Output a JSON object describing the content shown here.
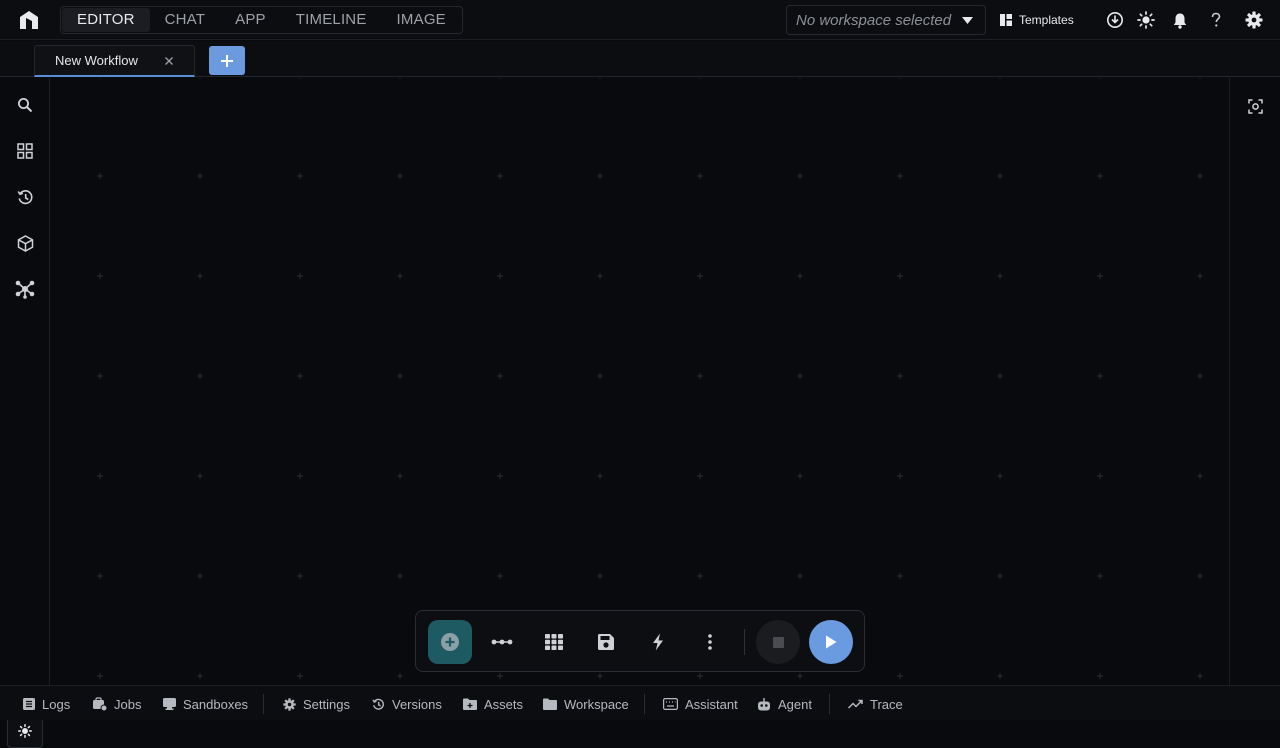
{
  "header": {
    "modes": [
      {
        "label": "EDITOR",
        "active": true
      },
      {
        "label": "CHAT",
        "active": false
      },
      {
        "label": "APP",
        "active": false
      },
      {
        "label": "TIMELINE",
        "active": false
      },
      {
        "label": "IMAGE",
        "active": false
      }
    ],
    "workspace_placeholder": "No workspace selected",
    "templates_label": "Templates",
    "icons": [
      "download-icon",
      "theme-sun-icon",
      "bell-icon",
      "help-icon",
      "gear-icon"
    ]
  },
  "tabs": [
    {
      "label": "New Workflow",
      "active": true
    }
  ],
  "sidebar": {
    "icons": [
      "search-icon",
      "grid-icon",
      "history-icon",
      "package-icon",
      "nodes-icon"
    ],
    "theme_icon": "sun-icon"
  },
  "canvas": {
    "fit_icon": "fit-view-icon"
  },
  "toolbar": {
    "icons": [
      "add-node-icon",
      "connect-icon",
      "layout-grid-icon",
      "save-icon",
      "bolt-icon",
      "more-icon",
      "stop-icon",
      "play-icon"
    ]
  },
  "bottombar": {
    "items": [
      {
        "label": "Logs",
        "icon": "list-icon"
      },
      {
        "label": "Jobs",
        "icon": "jobs-icon"
      },
      {
        "label": "Sandboxes",
        "icon": "sandbox-icon"
      },
      {
        "label": "Settings",
        "icon": "gear-icon"
      },
      {
        "label": "Versions",
        "icon": "history-icon"
      },
      {
        "label": "Assets",
        "icon": "folder-plus-icon"
      },
      {
        "label": "Workspace",
        "icon": "folder-icon"
      },
      {
        "label": "Assistant",
        "icon": "keyboard-icon"
      },
      {
        "label": "Agent",
        "icon": "robot-icon"
      },
      {
        "label": "Trace",
        "icon": "trend-icon"
      }
    ]
  },
  "colors": {
    "background": "#090a0d",
    "accent_blue": "#6a9be0",
    "accent_teal": "#1d5a62"
  }
}
